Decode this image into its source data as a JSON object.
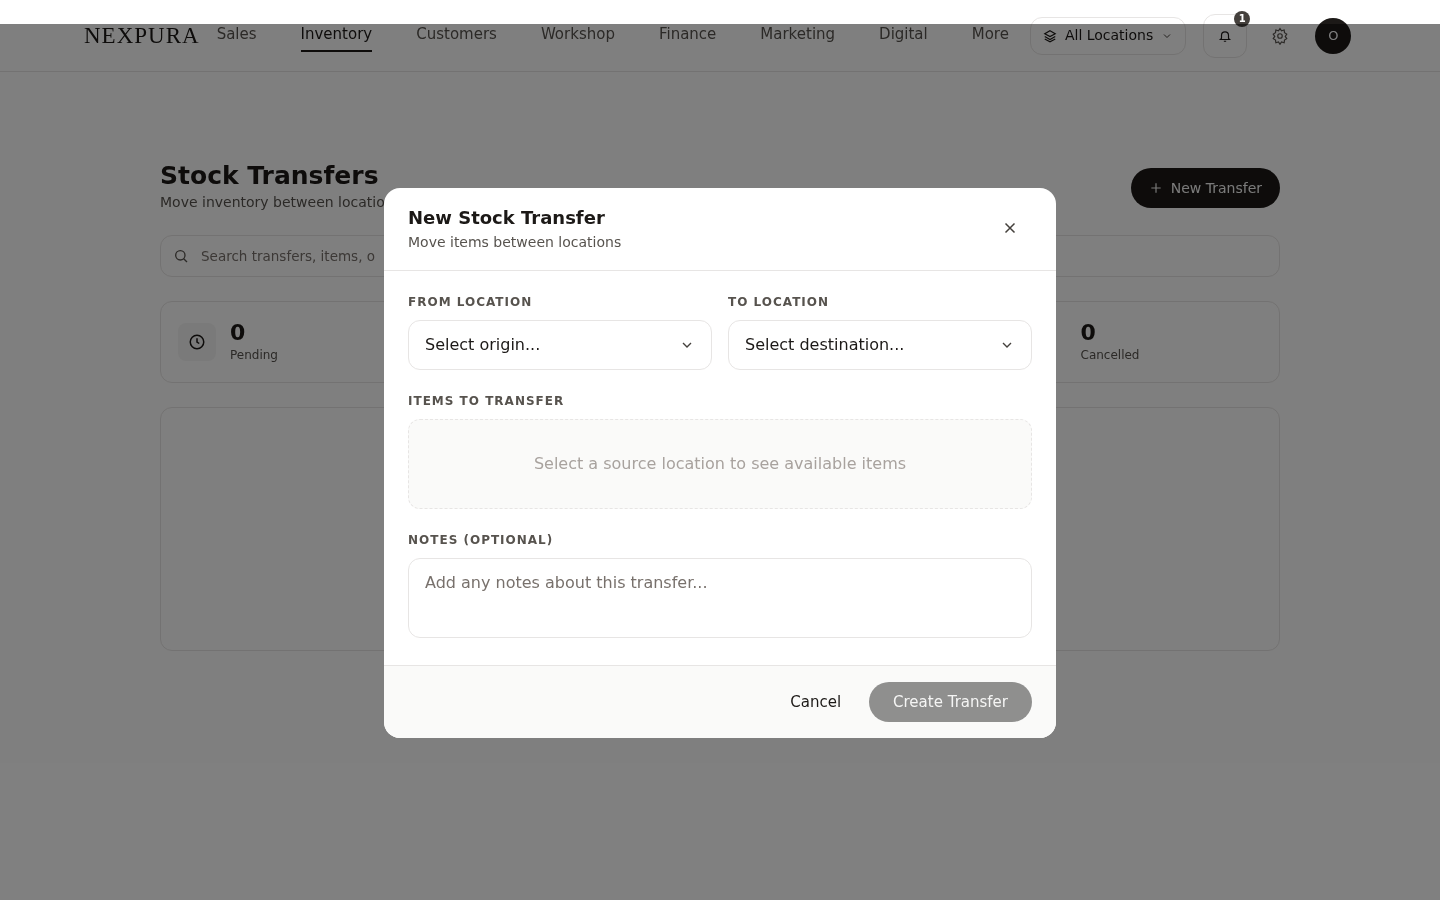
{
  "header": {
    "logo": "NEXPURA",
    "nav": [
      {
        "label": "Sales",
        "selected": false
      },
      {
        "label": "Inventory",
        "selected": true
      },
      {
        "label": "Customers",
        "selected": false
      },
      {
        "label": "Workshop",
        "selected": false
      },
      {
        "label": "Finance",
        "selected": false
      },
      {
        "label": "Marketing",
        "selected": false
      },
      {
        "label": "Digital",
        "selected": false
      },
      {
        "label": "More",
        "selected": false
      }
    ],
    "location_button": "All Locations",
    "notification_count": "1",
    "avatar": "O"
  },
  "page": {
    "title": "Stock Transfers",
    "subtitle": "Move inventory between locatio",
    "new_button": "New Transfer",
    "search": {
      "placeholder": "Search transfers, items, o"
    },
    "stats": [
      {
        "value": "0",
        "label": "Pending"
      },
      {
        "value": "0",
        "label": "Cancelled"
      }
    ]
  },
  "modal": {
    "title": "New Stock Transfer",
    "subtitle": "Move items between locations",
    "from": {
      "label": "FROM LOCATION",
      "placeholder": "Select origin..."
    },
    "to": {
      "label": "TO LOCATION",
      "placeholder": "Select destination..."
    },
    "items": {
      "label": "ITEMS TO TRANSFER",
      "empty_text": "Select a source location to see available items"
    },
    "notes": {
      "label": "NOTES (OPTIONAL)",
      "placeholder": "Add any notes about this transfer..."
    },
    "cancel": "Cancel",
    "submit": {
      "label": "Create Transfer",
      "disabled": true
    }
  }
}
